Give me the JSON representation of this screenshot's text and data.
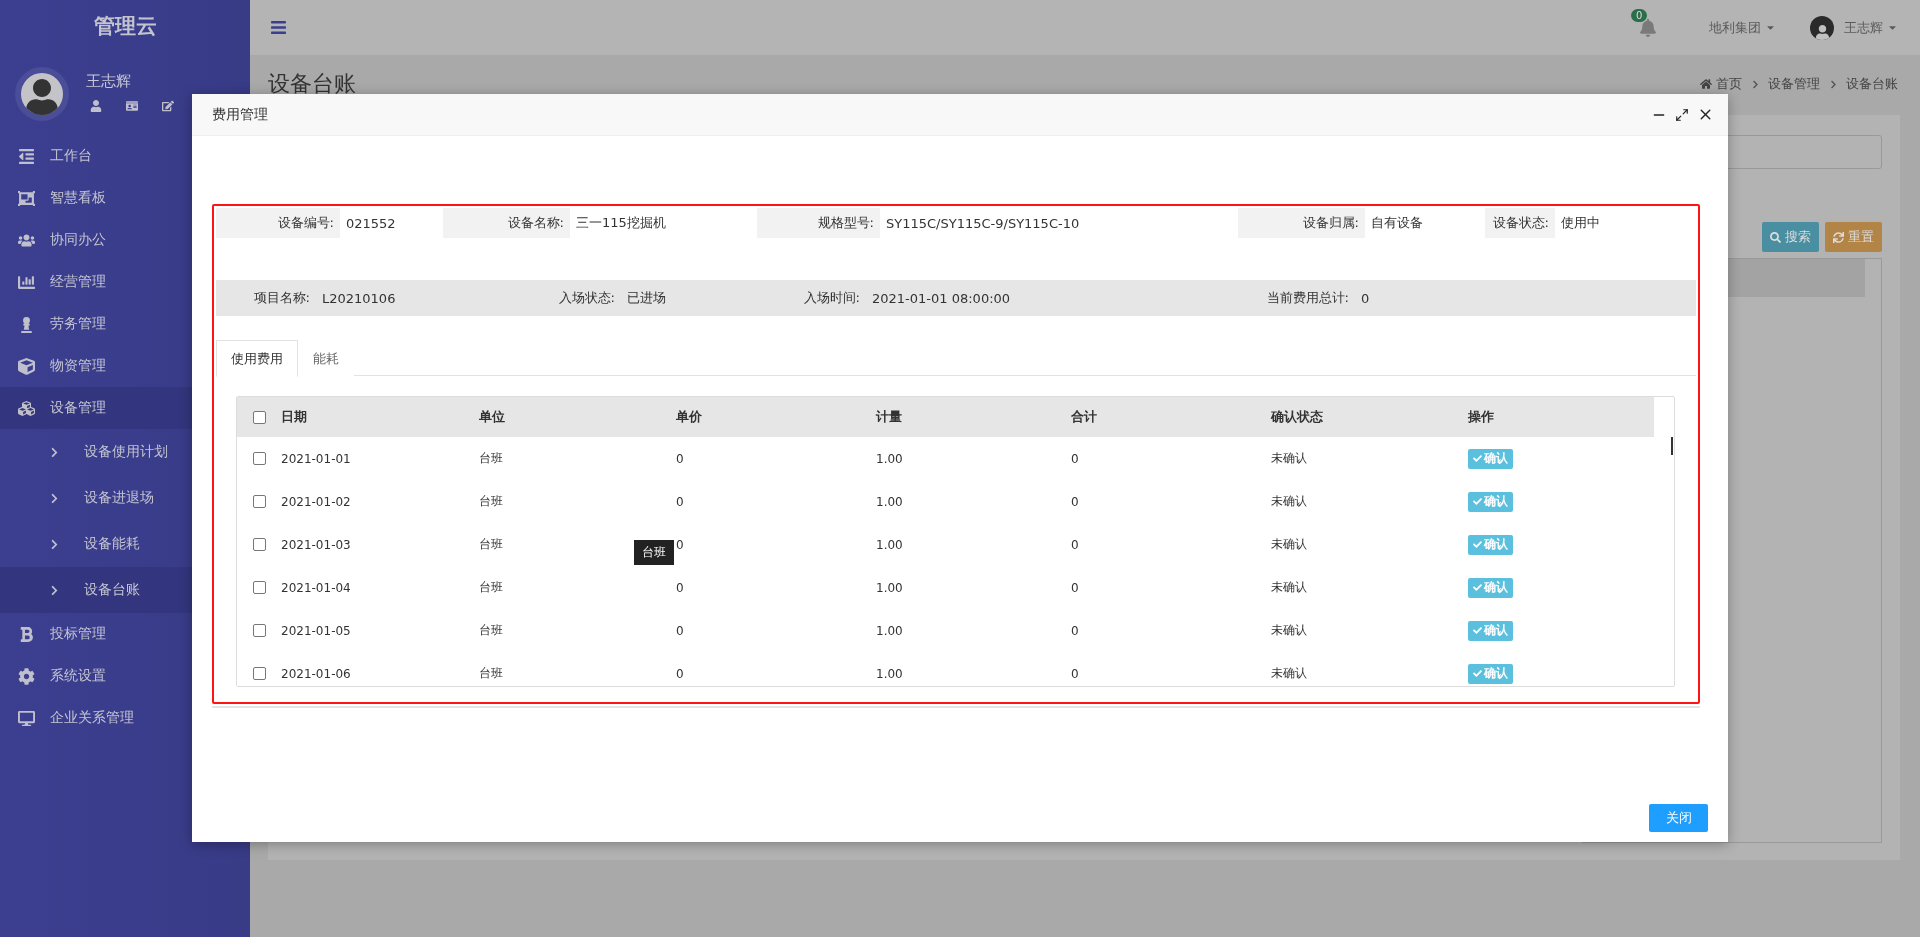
{
  "sidebar": {
    "brand": "管理云",
    "user": {
      "name": "王志辉"
    },
    "items": [
      {
        "label": "工作台",
        "selected": false,
        "expanded": false
      },
      {
        "label": "智慧看板",
        "selected": false,
        "expanded": false
      },
      {
        "label": "协同办公",
        "selected": false,
        "expanded": false
      },
      {
        "label": "经营管理",
        "selected": false,
        "expanded": false
      },
      {
        "label": "劳务管理",
        "selected": false,
        "expanded": false
      },
      {
        "label": "物资管理",
        "selected": false,
        "expanded": false
      },
      {
        "label": "设备管理",
        "selected": false,
        "expanded": true,
        "children": [
          {
            "label": "设备使用计划",
            "selected": false
          },
          {
            "label": "设备进退场",
            "selected": false
          },
          {
            "label": "设备能耗",
            "selected": false
          },
          {
            "label": "设备台账",
            "selected": true
          }
        ]
      },
      {
        "label": "投标管理",
        "selected": false,
        "expanded": false
      },
      {
        "label": "系统设置",
        "selected": false,
        "expanded": false
      },
      {
        "label": "企业关系管理",
        "selected": false,
        "expanded": false
      }
    ]
  },
  "header": {
    "notifications": "0",
    "company": "地利集团",
    "user": "王志辉"
  },
  "page": {
    "title": "设备台账",
    "breadcrumb": [
      "首页",
      "设备管理",
      "设备台账"
    ],
    "buttons": [
      "搜索",
      "重置"
    ]
  },
  "modal": {
    "title": "费用管理",
    "info_row_1": [
      {
        "label": "设备编号:",
        "value": "021552"
      },
      {
        "label": "设备名称:",
        "value": "三一115挖掘机"
      },
      {
        "label": "规格型号:",
        "value": "SY115C/SY115C-9/SY115C-10"
      },
      {
        "label": "设备归属:",
        "value": "自有设备"
      },
      {
        "label": "设备状态:",
        "value": "使用中"
      }
    ],
    "info_row_2": [
      {
        "label": "项目名称:",
        "value": "L20210106"
      },
      {
        "label": "入场状态:",
        "value": "已进场"
      },
      {
        "label": "入场时间:",
        "value": "2021-01-01 08:00:00"
      },
      {
        "label": "当前费用总计:",
        "value": "0"
      }
    ],
    "tabs": [
      {
        "label": "使用费用",
        "selected": true
      },
      {
        "label": "能耗",
        "selected": false
      }
    ],
    "table": {
      "all_checked": false,
      "columns": [
        "日期",
        "单位",
        "单价",
        "计量",
        "合计",
        "确认状态",
        "操作"
      ],
      "rows": [
        {
          "checked": false,
          "cells": [
            "2021-01-01",
            "台班",
            "0",
            "1.00",
            "0",
            "未确认"
          ],
          "action": "确认"
        },
        {
          "checked": false,
          "cells": [
            "2021-01-02",
            "台班",
            "0",
            "1.00",
            "0",
            "未确认"
          ],
          "action": "确认"
        },
        {
          "checked": false,
          "cells": [
            "2021-01-03",
            "台班",
            "0",
            "1.00",
            "0",
            "未确认"
          ],
          "action": "确认"
        },
        {
          "checked": false,
          "cells": [
            "2021-01-04",
            "台班",
            "0",
            "1.00",
            "0",
            "未确认"
          ],
          "action": "确认"
        },
        {
          "checked": false,
          "cells": [
            "2021-01-05",
            "台班",
            "0",
            "1.00",
            "0",
            "未确认"
          ],
          "action": "确认"
        },
        {
          "checked": false,
          "cells": [
            "2021-01-06",
            "台班",
            "0",
            "1.00",
            "0",
            "未确认"
          ],
          "action": "确认"
        }
      ]
    },
    "tooltip": "台班",
    "close_button": "关闭"
  }
}
